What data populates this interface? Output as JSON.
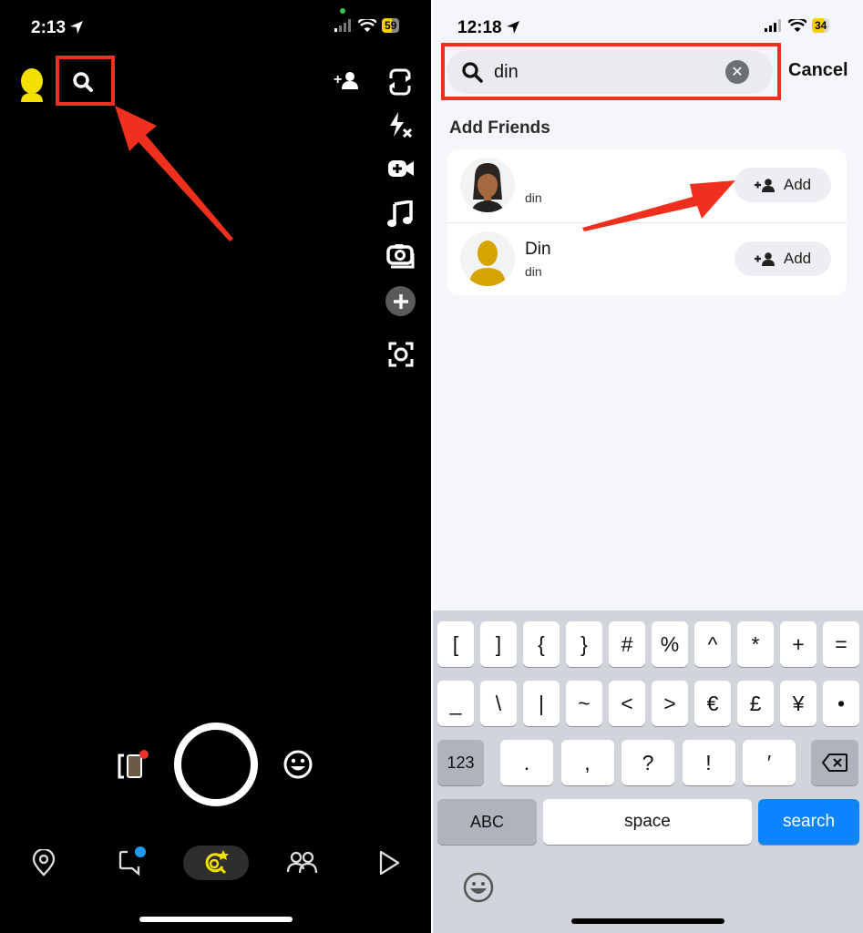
{
  "left_screen": {
    "status_bar": {
      "time": "2:13",
      "battery": "59",
      "battery_color": "#f5d000"
    },
    "header": {
      "avatar_color": "#f5e100",
      "search_icon": "search-icon",
      "add_friend_icon": "add-friend-icon"
    },
    "camera_rail": [
      "flip-camera-icon",
      "flash-off-icon",
      "video-effect-icon",
      "music-icon",
      "dual-camera-icon",
      "more-plus-icon",
      "scan-icon"
    ],
    "bottom_controls": {
      "memories_icon": "memories-icon",
      "lens_icon": "lens-emoji-icon",
      "notification_color": "#e8342b"
    },
    "nav": {
      "items": [
        "map-icon",
        "chat-icon",
        "lenses-camera-icon",
        "friends-icon",
        "spotlight-play-icon"
      ],
      "active": 2,
      "active_color": "#f5e100",
      "chat_badge_color": "#1e9bf0"
    },
    "annotation": {
      "color": "#f0301e",
      "target": "search-button"
    }
  },
  "right_screen": {
    "status_bar": {
      "time": "12:18",
      "battery": "34",
      "battery_color": "#f5d000"
    },
    "search": {
      "value": "din",
      "cancel_label": "Cancel"
    },
    "section_title": "Add Friends",
    "results": [
      {
        "display_name": "",
        "username": "din",
        "avatar": "bitmoji",
        "add_label": "Add"
      },
      {
        "display_name": "Din",
        "username": "din",
        "avatar": "default-silhouette",
        "add_label": "Add"
      }
    ],
    "annotation": {
      "color": "#f0301e",
      "target": "add-button-1"
    },
    "keyboard": {
      "row1": [
        "[",
        "]",
        "{",
        "}",
        "#",
        "%",
        "^",
        "*",
        "+",
        "="
      ],
      "row2": [
        "_",
        "\\",
        "|",
        "~",
        "<",
        ">",
        "€",
        "£",
        "¥",
        "•"
      ],
      "row3": {
        "mode": "123",
        "keys": [
          ".",
          ",",
          "?",
          "!",
          "′"
        ],
        "delete_icon": "backspace-icon"
      },
      "row4": {
        "abc": "ABC",
        "space": "space",
        "action": "search"
      },
      "emoji_icon": "emoji-icon"
    }
  }
}
